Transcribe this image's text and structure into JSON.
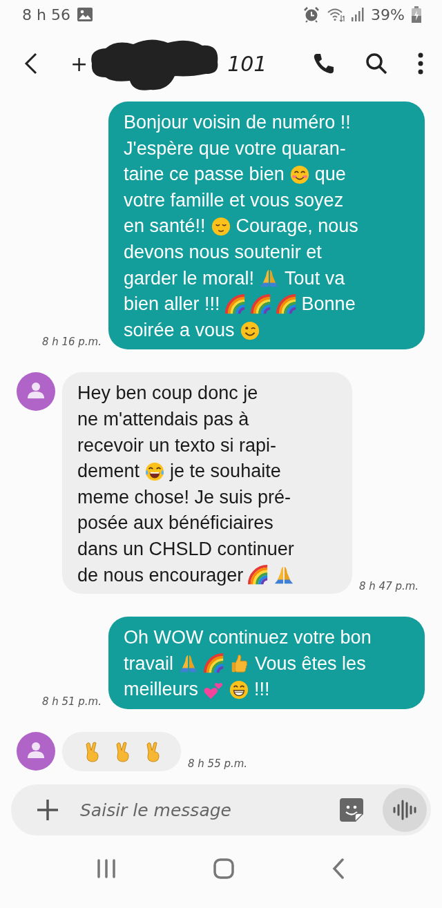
{
  "status_bar": {
    "time": "8 h 56",
    "battery": "39%"
  },
  "header": {
    "title_start": "+",
    "title_end": "101"
  },
  "messages": [
    {
      "kind": "sent",
      "time": "8 h 16 p.m.",
      "lines": [
        [
          {
            "kind": "text",
            "text": "Bonjour voisin de numéro !!"
          }
        ],
        [
          {
            "kind": "text",
            "text": "J'espère que votre quaran-"
          }
        ],
        [
          {
            "kind": "text",
            "text": "taine ce passe bien"
          },
          {
            "kind": "blush"
          },
          {
            "kind": "text",
            "text": "que"
          }
        ],
        [
          {
            "kind": "text",
            "text": "votre famille et vous soyez"
          }
        ],
        [
          {
            "kind": "text",
            "text": "en santé!!"
          },
          {
            "kind": "relieved"
          },
          {
            "kind": "text",
            "text": "Courage, nous"
          }
        ],
        [
          {
            "kind": "text",
            "text": "devons nous soutenir et"
          }
        ],
        [
          {
            "kind": "text",
            "text": "garder le moral!"
          },
          {
            "kind": "pray"
          },
          {
            "kind": "text",
            "text": "Tout va"
          }
        ],
        [
          {
            "kind": "text",
            "text": "bien aller !!!"
          },
          {
            "kind": "rainbow"
          },
          {
            "kind": "rainbow"
          },
          {
            "kind": "rainbow"
          },
          {
            "kind": "text",
            "text": "Bonne"
          }
        ],
        [
          {
            "kind": "text",
            "text": "soirée a vous"
          },
          {
            "kind": "wink"
          }
        ]
      ]
    },
    {
      "kind": "received",
      "time": "8 h 47 p.m.",
      "lines": [
        [
          {
            "kind": "text",
            "text": "Hey ben coup donc je"
          }
        ],
        [
          {
            "kind": "text",
            "text": "ne m'attendais pas à"
          }
        ],
        [
          {
            "kind": "text",
            "text": "recevoir un texto si rapi-"
          }
        ],
        [
          {
            "kind": "text",
            "text": "dement"
          },
          {
            "kind": "joy"
          },
          {
            "kind": "text",
            "text": "je te souhaite"
          }
        ],
        [
          {
            "kind": "text",
            "text": "meme chose! Je suis pré-"
          }
        ],
        [
          {
            "kind": "text",
            "text": "posée aux bénéficiaires"
          }
        ],
        [
          {
            "kind": "text",
            "text": "dans un CHSLD continuer"
          }
        ],
        [
          {
            "kind": "text",
            "text": "de nous encourager"
          },
          {
            "kind": "rainbow"
          },
          {
            "kind": "pray"
          }
        ]
      ]
    },
    {
      "kind": "sent",
      "time": "8 h 51 p.m.",
      "lines": [
        [
          {
            "kind": "text",
            "text": "Oh WOW continuez votre bon"
          }
        ],
        [
          {
            "kind": "text",
            "text": "travail"
          },
          {
            "kind": "pray"
          },
          {
            "kind": "rainbow"
          },
          {
            "kind": "thumbs"
          },
          {
            "kind": "text",
            "text": "Vous êtes les"
          }
        ],
        [
          {
            "kind": "text",
            "text": "meilleurs"
          },
          {
            "kind": "hearts"
          },
          {
            "kind": "grin"
          },
          {
            "kind": "text",
            "text": "!!!"
          }
        ]
      ]
    },
    {
      "kind": "received",
      "time": "8 h 55 p.m.",
      "lines": [
        [
          {
            "kind": "victory"
          },
          {
            "kind": "victory"
          },
          {
            "kind": "victory"
          }
        ]
      ]
    }
  ],
  "composer": {
    "placeholder": "Saisir le message"
  }
}
